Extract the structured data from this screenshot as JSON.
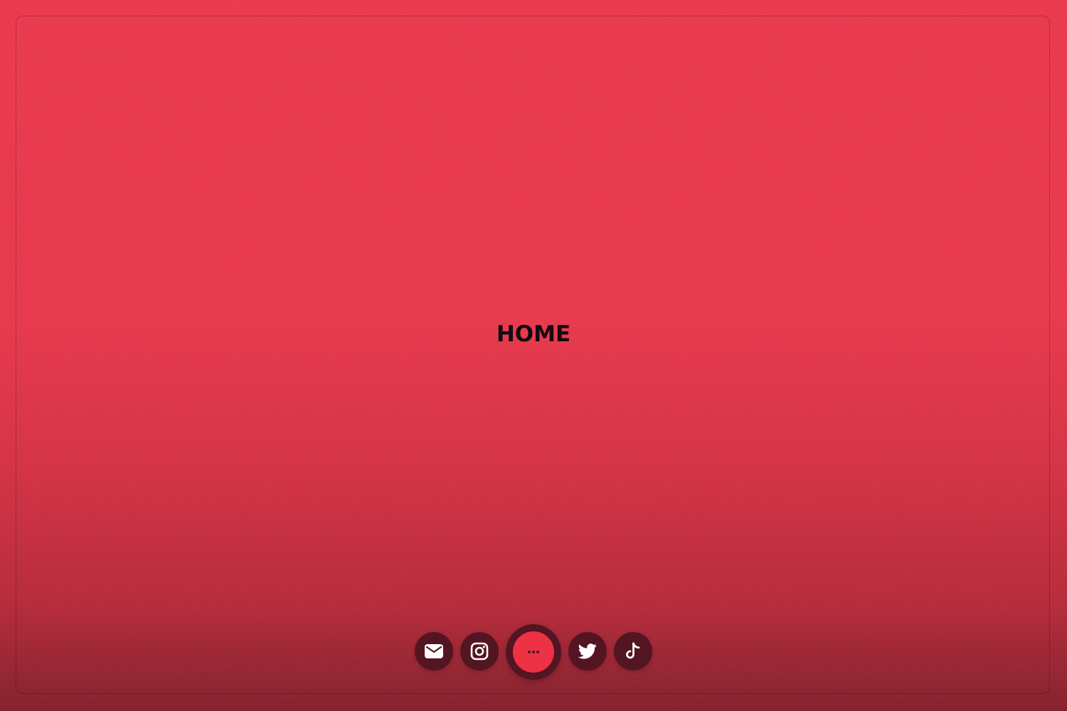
{
  "page": {
    "title": "HOME"
  },
  "theme": {
    "background_top": "#ee2f45",
    "background_bottom": "#7e1522",
    "dock_button_color": "#531521",
    "accent": "#ee3246",
    "title_color": "#140b10",
    "icon_color": "#ffffff"
  },
  "dock": {
    "items": [
      {
        "icon": "mail-icon"
      },
      {
        "icon": "instagram-icon"
      },
      {
        "icon": "more-icon"
      },
      {
        "icon": "twitter-icon"
      },
      {
        "icon": "tiktok-icon"
      }
    ]
  }
}
